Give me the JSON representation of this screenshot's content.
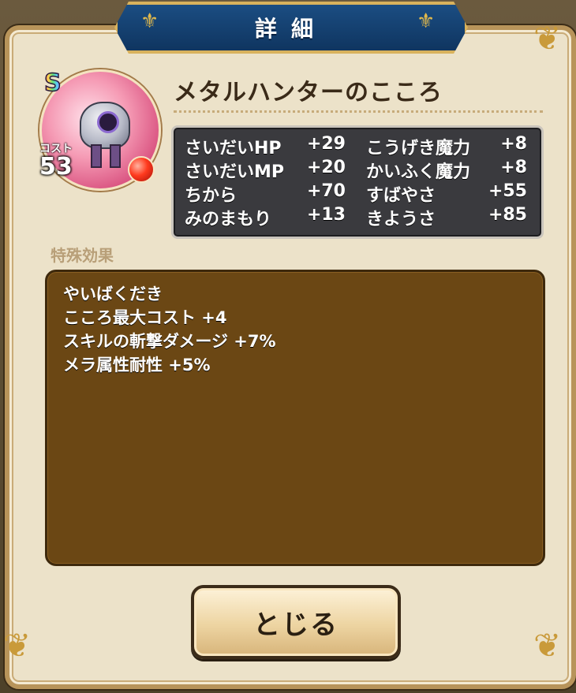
{
  "dialog": {
    "title": "詳細",
    "close_label": "とじる"
  },
  "heart": {
    "rank": "S",
    "name": "メタルハンターのこころ",
    "cost_label": "コスト",
    "cost_value": "53",
    "element_color": "#e8281a"
  },
  "stats": [
    {
      "name": "さいだいHP",
      "value": "+29"
    },
    {
      "name": "こうげき魔力",
      "value": "+8"
    },
    {
      "name": "さいだいMP",
      "value": "+20"
    },
    {
      "name": "かいふく魔力",
      "value": "+8"
    },
    {
      "name": "ちから",
      "value": "+70"
    },
    {
      "name": "すばやさ",
      "value": "+55"
    },
    {
      "name": "みのまもり",
      "value": "+13"
    },
    {
      "name": "きようさ",
      "value": "+85"
    }
  ],
  "special": {
    "label": "特殊効果",
    "effects": [
      "やいばくだき",
      "こころ最大コスト +4",
      "スキルの斬撃ダメージ +7%",
      "メラ属性耐性 +5%"
    ]
  },
  "colors": {
    "title_bar": "#1b4d82",
    "panel": "#ece2c9",
    "effect_box": "#6b4714",
    "stats_box": "#3a3a3e"
  },
  "icons": {
    "heart_icon": "monster-heart-icon",
    "element_icon": "fire-element-icon",
    "ornament": "fleur-de-lis-icon"
  }
}
